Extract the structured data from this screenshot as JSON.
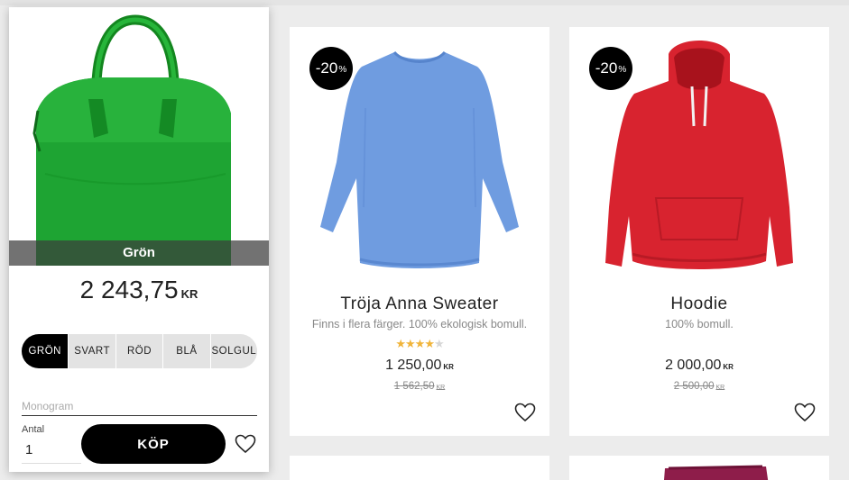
{
  "selected_product": {
    "variant_caption": "Grön",
    "price": "2 243,75",
    "currency": "KR",
    "image_icon": "green-handbag-image",
    "colors": [
      {
        "label": "GRÖN",
        "active": true
      },
      {
        "label": "SVART",
        "active": false
      },
      {
        "label": "RÖD",
        "active": false
      },
      {
        "label": "BLÅ",
        "active": false
      },
      {
        "label": "SOLGUL",
        "active": false
      }
    ],
    "monogram_placeholder": "Monogram",
    "quantity_label": "Antal",
    "quantity_value": "1",
    "buy_label": "KÖP",
    "wishlist_icon": "heart-icon"
  },
  "products": [
    {
      "badge_value": "-20",
      "badge_unit": "%",
      "title": "Tröja Anna Sweater",
      "description": "Finns i flera färger. 100% ekologisk bomull.",
      "rating": 4,
      "rating_max": 5,
      "price": "1 250,00",
      "currency": "KR",
      "old_price": "1 562,50",
      "old_currency": "KR",
      "image_icon": "blue-sweater-image",
      "color": "#6f9ce0"
    },
    {
      "badge_value": "-20",
      "badge_unit": "%",
      "title": "Hoodie",
      "description": "100% bomull.",
      "price": "2 000,00",
      "currency": "KR",
      "old_price": "2 500,00",
      "old_currency": "KR",
      "image_icon": "red-hoodie-image",
      "color": "#d8232f"
    }
  ],
  "colors": {
    "background": "#ececec",
    "accent": "#000000",
    "star": "#f0b43a",
    "bag": "#1ea433"
  }
}
